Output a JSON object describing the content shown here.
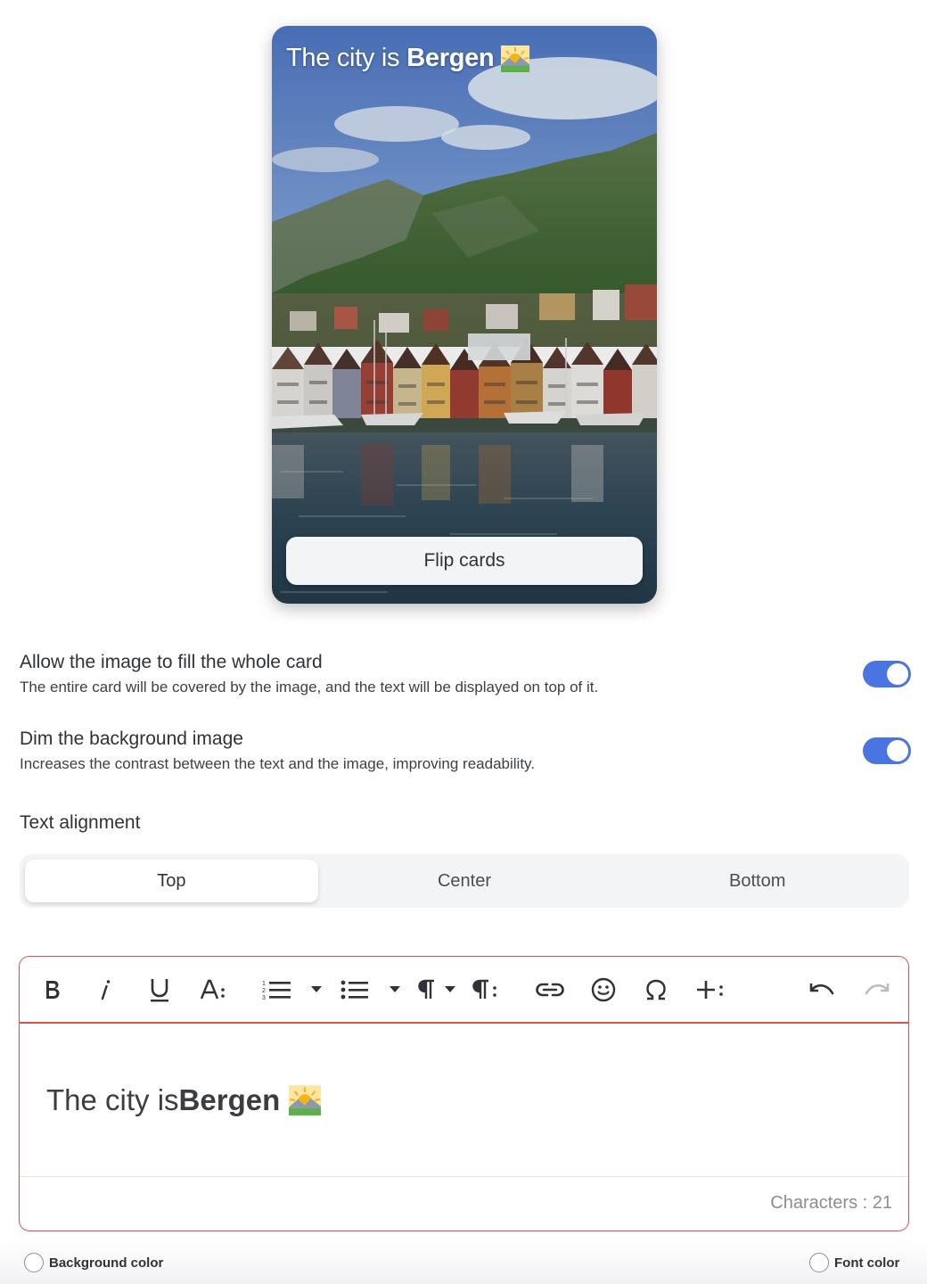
{
  "card": {
    "title_prefix": "The city is ",
    "title_bold": "Bergen",
    "title_emoji": "sunrise-over-mountains-emoji",
    "background_image": "Bergen harbor with colorful wooden houses, mountain and water",
    "flip_button_label": "Flip cards"
  },
  "settings": [
    {
      "title": "Allow the image to fill the whole card",
      "description": "The entire card will be covered by the image, and the text will be displayed on top of it.",
      "enabled": true
    },
    {
      "title": "Dim the background image",
      "description": "Increases the contrast between the text and the image, improving readability.",
      "enabled": true
    }
  ],
  "text_alignment": {
    "label": "Text alignment",
    "options": [
      "Top",
      "Center",
      "Bottom"
    ],
    "selected": "Top"
  },
  "editor": {
    "toolbar_icons": [
      "bold-icon",
      "italic-icon",
      "underline-icon",
      "font-size-icon",
      "ordered-list-icon",
      "chevron-down-icon",
      "unordered-list-icon",
      "chevron-down-icon",
      "paragraph-format-icon",
      "chevron-down-icon",
      "paragraph-style-icon",
      "link-icon",
      "emoji-icon",
      "special-character-icon",
      "insert-more-icon",
      "undo-icon",
      "redo-icon"
    ],
    "content_prefix": "The city is ",
    "content_bold": "Bergen",
    "character_count_label": "Characters : 21"
  },
  "colors": {
    "accent": "#4b74e3",
    "editor_border": "#d9534f",
    "segment_bg": "#f3f4f6"
  },
  "pickers": {
    "background_color_label": "Background color",
    "font_color_label": "Font color"
  }
}
